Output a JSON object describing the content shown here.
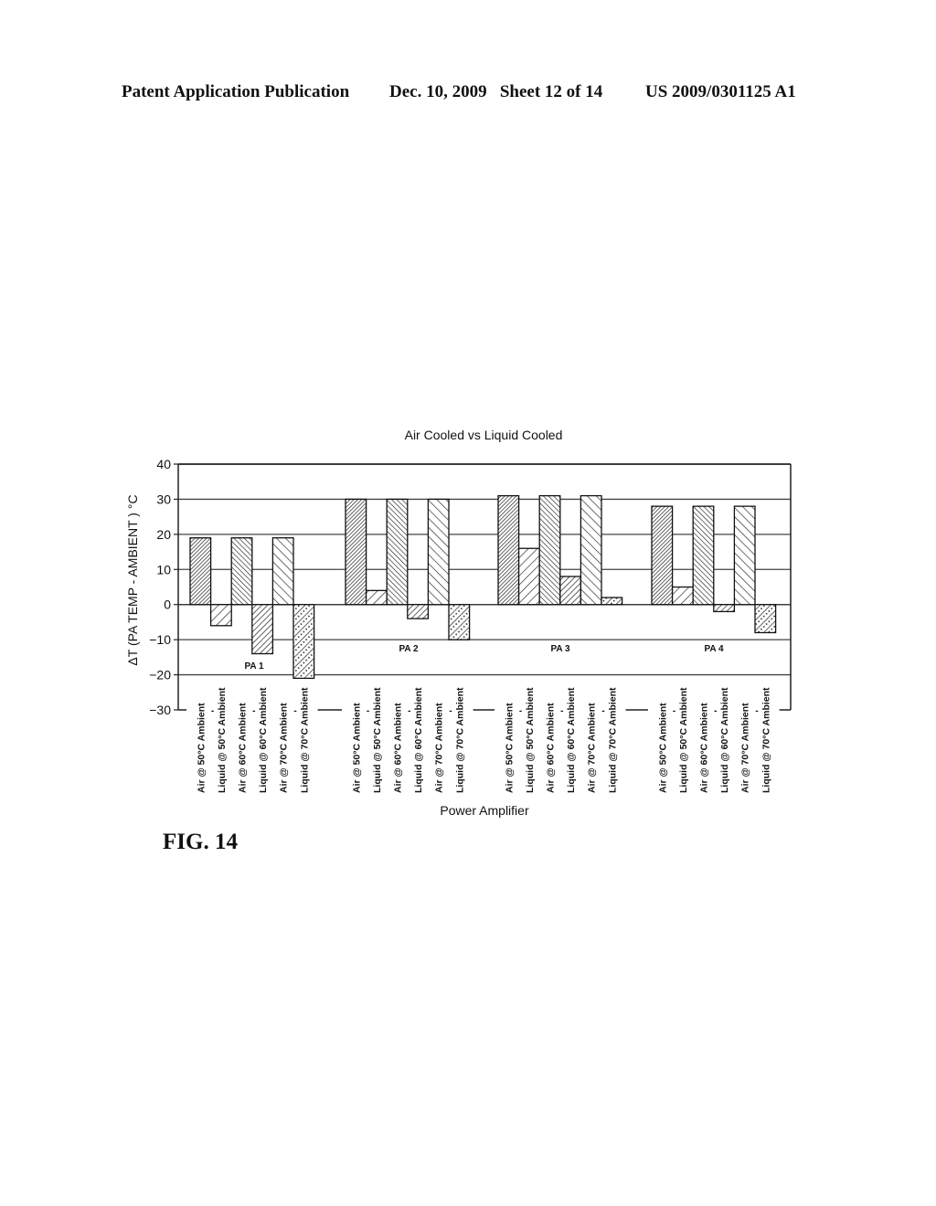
{
  "header": {
    "publication": "Patent Application Publication",
    "date_sheet": "Dec. 10, 2009   Sheet 12 of 14",
    "patent_number": "US 2009/0301125 A1"
  },
  "figure_label": "FIG. 14",
  "chart_data": {
    "type": "bar",
    "title": "Air Cooled vs Liquid Cooled",
    "xlabel": "Power Amplifier",
    "ylabel": "ΔT (PA TEMP - AMBIENT ) °C",
    "ylim": [
      -30,
      40
    ],
    "yticks": [
      40,
      30,
      20,
      10,
      0,
      -10,
      -20,
      -30
    ],
    "grid": true,
    "legend": "none",
    "groups": [
      "PA 1",
      "PA 2",
      "PA 3",
      "PA 4"
    ],
    "categories": [
      "Air @ 50°C Ambient",
      "Liquid @ 50°C Ambient",
      "Air @ 60°C Ambient",
      "Liquid @ 60°C Ambient",
      "Air @ 70°C Ambient",
      "Liquid @ 70°C Ambient"
    ],
    "series": [
      {
        "name": "PA 1",
        "values": [
          19,
          -6,
          19,
          -14,
          19,
          -21
        ]
      },
      {
        "name": "PA 2",
        "values": [
          30,
          4,
          30,
          -4,
          30,
          -10
        ]
      },
      {
        "name": "PA 3",
        "values": [
          31,
          16,
          31,
          8,
          31,
          2
        ]
      },
      {
        "name": "PA 4",
        "values": [
          28,
          5,
          28,
          -2,
          28,
          -8
        ]
      }
    ]
  }
}
